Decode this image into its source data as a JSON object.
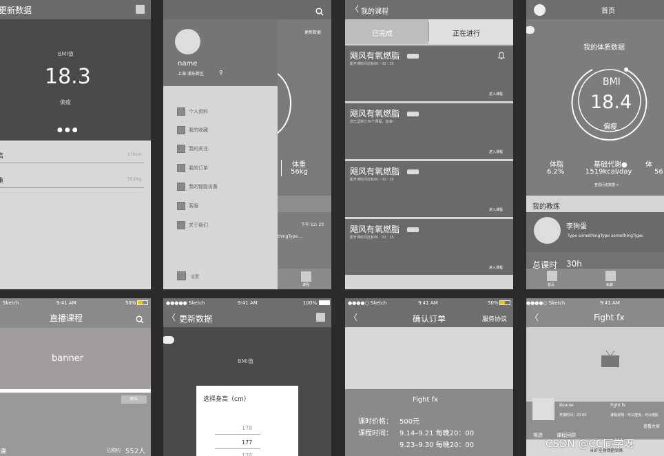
{
  "p1": {
    "title": "更新数据",
    "bmi_label": "BMI值",
    "bmi_value": "18.3",
    "bmi_status": "偏瘦",
    "row1_label": "高",
    "row1_value": "178cm",
    "row2_label": "重",
    "row2_value": "56.0kg"
  },
  "p2": {
    "name": "name",
    "location": "上海  浦东新区",
    "update_link": "更新数据",
    "menu": [
      "个人资料",
      "我的收藏",
      "我的关注",
      "我的订单",
      "我的智能设备",
      "客服",
      "关于我们"
    ],
    "settings": "设置",
    "weight_label": "体重",
    "weight_value": "56kg",
    "time": "下午 12: 23",
    "snippet": "thingType....",
    "tab_course": "课程"
  },
  "p3": {
    "title": "我的课程",
    "tab_done": "已完成",
    "tab_progress": "正在进行",
    "cards": [
      {
        "title": "飓风有氧燃脂",
        "sub": "距开课时间还有00 : 02 : 35",
        "enter": "进入课程"
      },
      {
        "title": "飓风有氧燃脂",
        "sub": "您已坚持了30个课程，加油！",
        "enter": "进入课程"
      },
      {
        "title": "飓风有氧燃脂",
        "sub": "距开课时间还有00 : 02 : 35",
        "enter": "进入课程"
      },
      {
        "title": "飓风有氧燃脂",
        "sub": "距开课时间还有00 : 02 : 35",
        "enter": "进入课程"
      }
    ]
  },
  "p4": {
    "title": "首页",
    "section": "我的体质数据",
    "bmi_label": "BMI",
    "bmi_value": "18.4",
    "bmi_status": "偏瘦",
    "stats": [
      {
        "label": "体脂",
        "value": "6.2%"
      },
      {
        "label": "基础代谢●",
        "value": "1519kcal/day"
      },
      {
        "label": "体",
        "value": "56"
      }
    ],
    "history": "查看历史数据 >",
    "coach_section": "我的教练",
    "coach_name": "李狗蛋",
    "coach_desc": "Type somethingType somethingType.",
    "total_label": "总课时",
    "total_value": "30h",
    "tab_home": "首页",
    "tab_private": "私教"
  },
  "p5": {
    "carrier": "Sketch",
    "time": "9:41 AM",
    "battery": "50%",
    "title": "直播课程",
    "banner": "banner",
    "badge": "预告",
    "footer_left": "课",
    "footer_right_label": "已预约",
    "footer_right_value": "552人"
  },
  "p6": {
    "carrier": "●●●●● Sketch",
    "time": "9:41 AM",
    "battery": "100%",
    "title": "更新数据",
    "bmi_label": "BMI值",
    "picker_title": "选择身高（cm）",
    "picker_values": [
      "178",
      "177",
      "176"
    ]
  },
  "p7": {
    "carrier": "●●●●○ Sketch",
    "time": "9:41 AM",
    "battery": "50%",
    "title": "确认订单",
    "right_link": "服务协议",
    "course": "Fight fx",
    "price_label": "课时价格：",
    "price_value": "500元",
    "time_label": "课程时间：",
    "time_row1": "9.14–9.21  每晚20：00",
    "time_row2": "9.23–9.30  每晚20：00"
  },
  "p8": {
    "carrier": "●●●●○ Sketch",
    "time": "9:41 AM",
    "title": "Fight fx",
    "coach_name": "Bonnie",
    "coach_sub": "开播时间：20:00",
    "course_name": "Fight fx",
    "course_sub": "课程说明：可以瘦身，可以增肌",
    "more": "查看大家",
    "tab_filter": "筛选",
    "tab_review": "课程回顾",
    "hiit": "HIIT全身燃脂训练"
  },
  "watermark": "CSDN @CC同学呀"
}
